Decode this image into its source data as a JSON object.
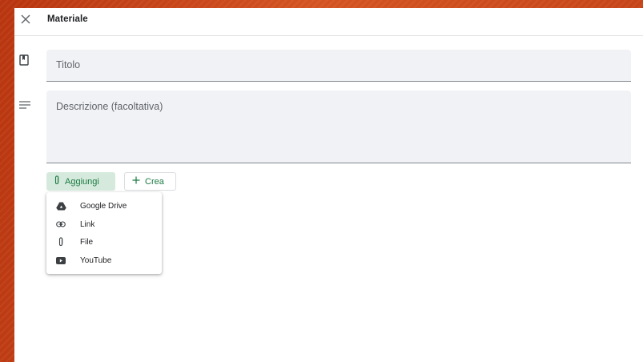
{
  "header": {
    "title": "Materiale"
  },
  "form": {
    "title_placeholder": "Titolo",
    "description_placeholder": "Descrizione (facoltativa)"
  },
  "actions": {
    "add_label": "Aggiungi",
    "create_label": "Crea"
  },
  "add_menu": {
    "items": [
      {
        "label": "Google Drive",
        "icon": "google-drive-icon"
      },
      {
        "label": "Link",
        "icon": "link-icon"
      },
      {
        "label": "File",
        "icon": "paperclip-icon"
      },
      {
        "label": "YouTube",
        "icon": "youtube-icon"
      }
    ]
  },
  "colors": {
    "accent_green": "#1b7a43",
    "add_button_bg": "#d5eadc",
    "field_bg": "#f1f2f6",
    "background_orange": "#c2401a"
  }
}
